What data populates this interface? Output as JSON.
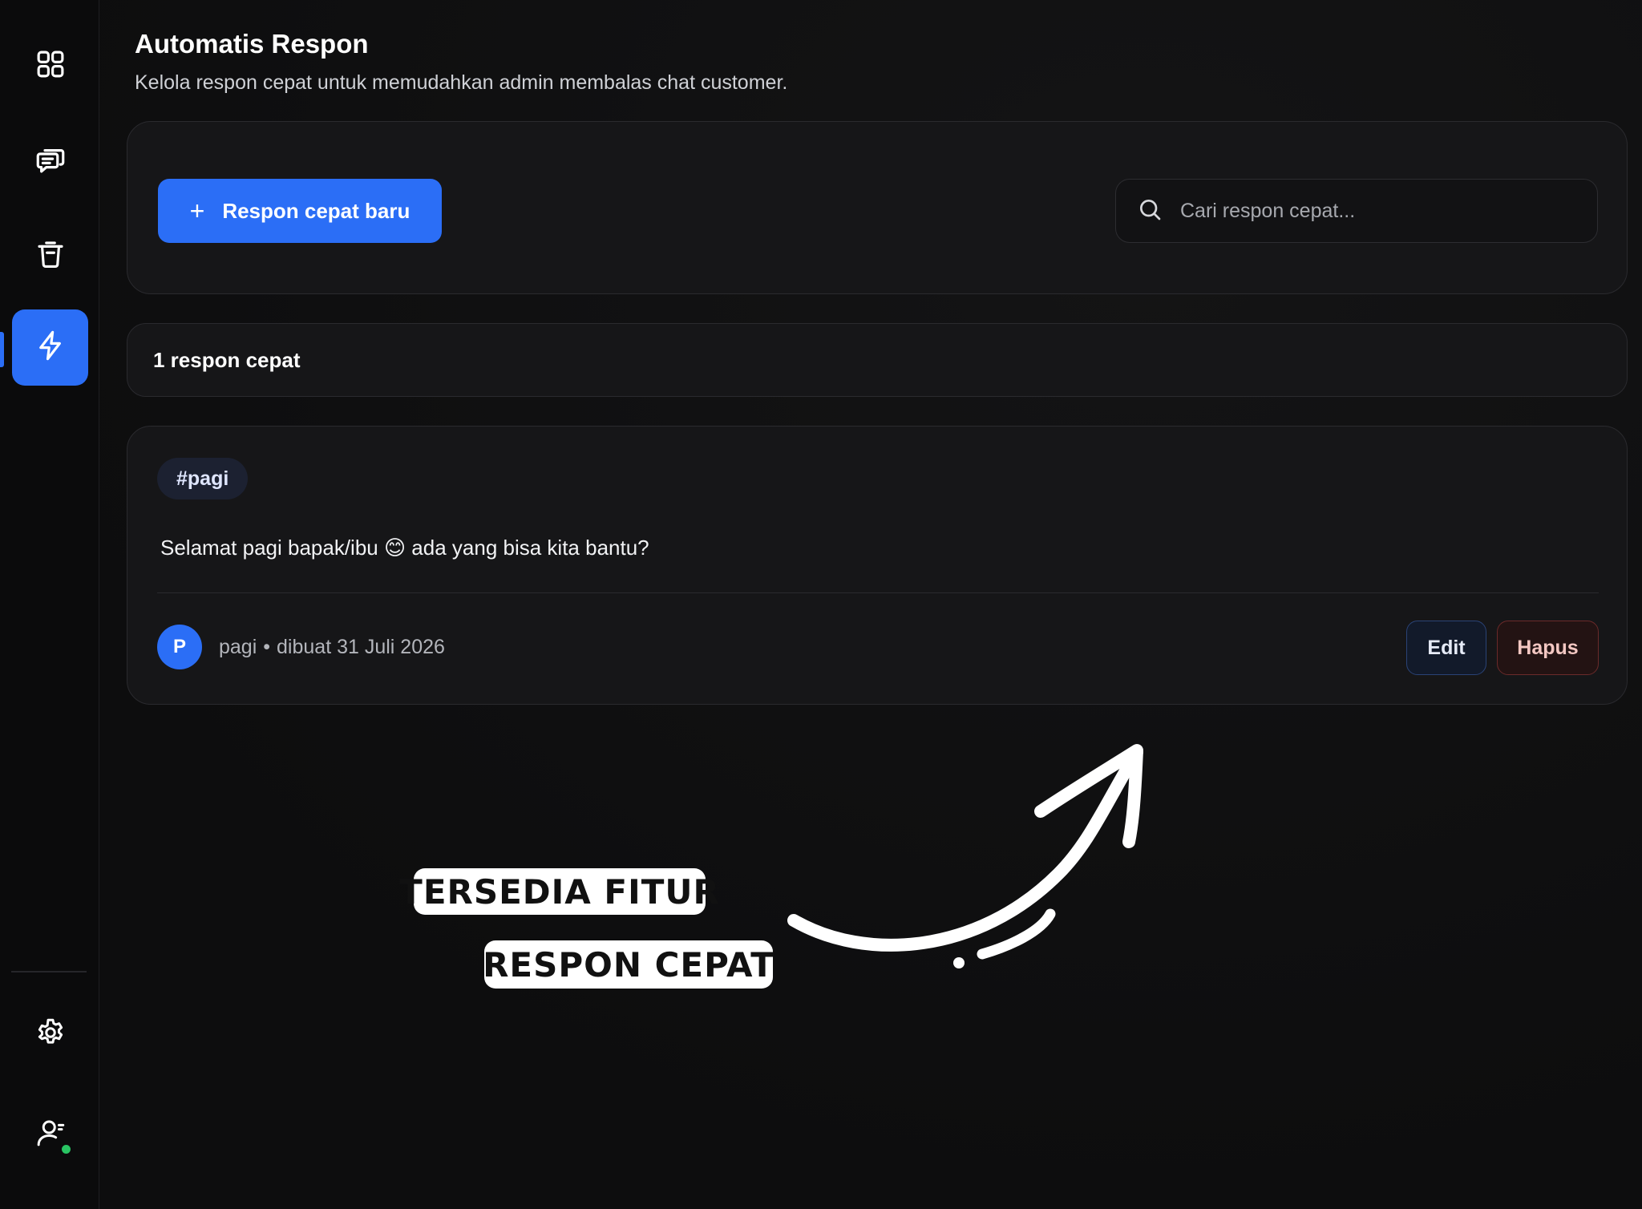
{
  "sidebar": {
    "items": [
      {
        "icon": "dashboard-grid-icon",
        "active": false
      },
      {
        "icon": "chat-icon",
        "active": false
      },
      {
        "icon": "trash-icon",
        "active": false
      },
      {
        "icon": "lightning-icon",
        "active": true
      }
    ],
    "bottom_items": [
      {
        "icon": "settings-gear-icon"
      },
      {
        "icon": "user-profile-icon",
        "status": "online"
      }
    ]
  },
  "header": {
    "title": "Automatis Respon",
    "subtitle": "Kelola respon cepat untuk memudahkan admin membalas chat customer."
  },
  "toolbar": {
    "new_button_icon": "+",
    "new_button_label": "Respon cepat baru",
    "search_placeholder": "Cari respon cepat..."
  },
  "summary": {
    "count_text": "1 respon cepat"
  },
  "responses": [
    {
      "tag": "#pagi",
      "message": "Selamat pagi bapak/ibu 😊 ada yang bisa kita bantu?",
      "avatar_initial": "P",
      "author": "pagi",
      "separator": "•",
      "created": "dibuat 31 Juli 2026",
      "edit_label": "Edit",
      "delete_label": "Hapus"
    }
  ],
  "overlay": {
    "line1": "TERSEDIA FITUR",
    "line2": "RESPON CEPAT"
  },
  "colors": {
    "accent": "#2b6ef6",
    "background": "#0e0e0f",
    "card": "#161618",
    "online": "#29c463",
    "danger_text": "#f3c7c2"
  }
}
